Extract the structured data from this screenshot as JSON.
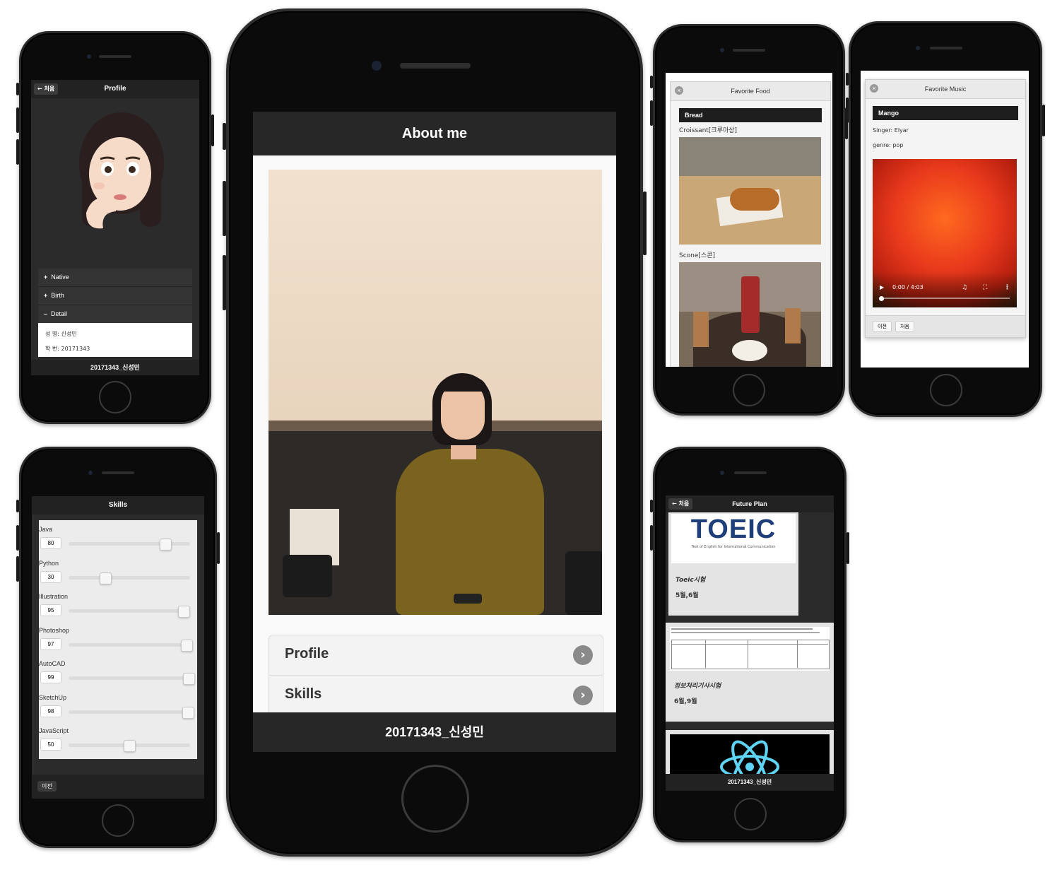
{
  "main": {
    "header_title": "About me",
    "list_items": [
      {
        "label": "Profile"
      },
      {
        "label": "Skills"
      }
    ],
    "footer_text": "20171343_신성민"
  },
  "profile": {
    "back_label": "처음",
    "title": "Profile",
    "accordion": [
      {
        "icon": "plus-icon",
        "label": "Native"
      },
      {
        "icon": "plus-icon",
        "label": "Birth"
      },
      {
        "icon": "minus-icon",
        "label": "Detail"
      }
    ],
    "detail_lines": [
      "성 명: 신성민",
      "학 번: 20171343"
    ],
    "footer_text": "20171343_신성민"
  },
  "skills": {
    "title": "Skills",
    "items": [
      {
        "label": "Java",
        "value": "80"
      },
      {
        "label": "Python",
        "value": "30"
      },
      {
        "label": "Illustration",
        "value": "95"
      },
      {
        "label": "Photoshop",
        "value": "97"
      },
      {
        "label": "AutoCAD",
        "value": "99"
      },
      {
        "label": "SketchUp",
        "value": "98"
      },
      {
        "label": "JavaScript",
        "value": "50"
      }
    ],
    "prev_label": "이전"
  },
  "food": {
    "title": "Favorite Food",
    "category": "Bread",
    "items": [
      {
        "label": "Croissant[크루아상]"
      },
      {
        "label": "Scone[스콘]"
      }
    ]
  },
  "music": {
    "title": "Favorite Music",
    "song": "Mango",
    "singer": "Singer: Elyar",
    "genre": "genre: pop",
    "time": "0:00 / 4:03",
    "prev_label": "이전",
    "home_label": "처음"
  },
  "future": {
    "back_label": "처음",
    "title": "Future Plan",
    "toeic_logo": "TOEIC",
    "toeic_tagline": "Test of English for International Communication",
    "cards": [
      {
        "title": "Toeic시험",
        "date": "5월,6월"
      },
      {
        "title": "정보처리기사시험",
        "date": "6월,9월"
      }
    ],
    "footer_text": "20171343_신성민"
  }
}
